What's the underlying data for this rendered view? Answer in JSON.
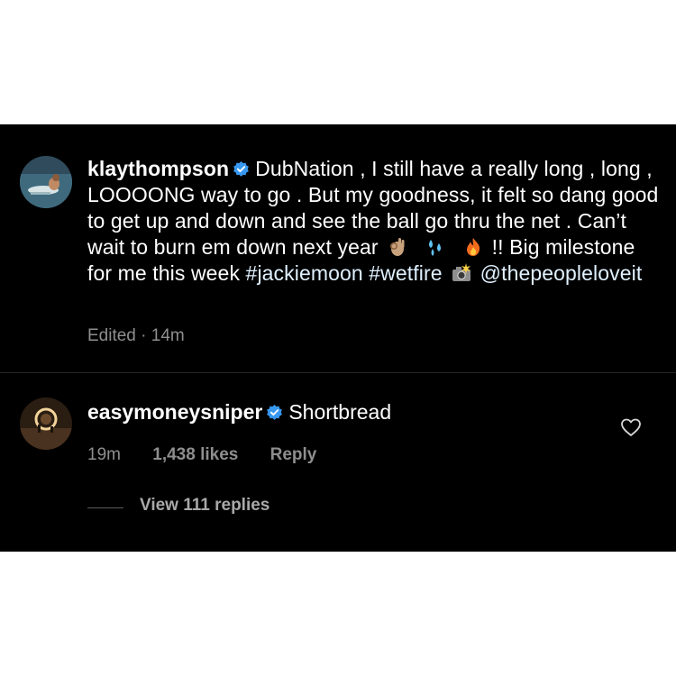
{
  "post_comment": {
    "username": "klaythompson",
    "text_1": "DubNation , I still have a really long , long , LOOOONG way to go . But my goodness, it felt so dang good to get up and down and see the ball go thru the net . Can’t wait to burn em down next year",
    "emoji_1": "ok-hand-icon",
    "emoji_2": "sweat-droplets-icon",
    "emoji_3": "fire-icon",
    "text_2": "!! Big milestone for me this week",
    "hashtag_1": "#jackiemoon",
    "hashtag_2": "#wetfire",
    "emoji_4": "camera-flash-icon",
    "mention": "@thepeopleloveit",
    "edited_label": "Edited",
    "separator": "·",
    "time": "14m"
  },
  "reply_comment": {
    "username": "easymoneysniper",
    "text": "Shortbread",
    "time": "19m",
    "likes": "1,438 likes",
    "reply_label": "Reply",
    "view_replies": "View 111 replies"
  },
  "colors": {
    "background": "#000000",
    "text": "#ffffff",
    "secondary_text": "#8e8e8e",
    "verified_badge": "#3897f0",
    "link": "#e0f1ff"
  }
}
